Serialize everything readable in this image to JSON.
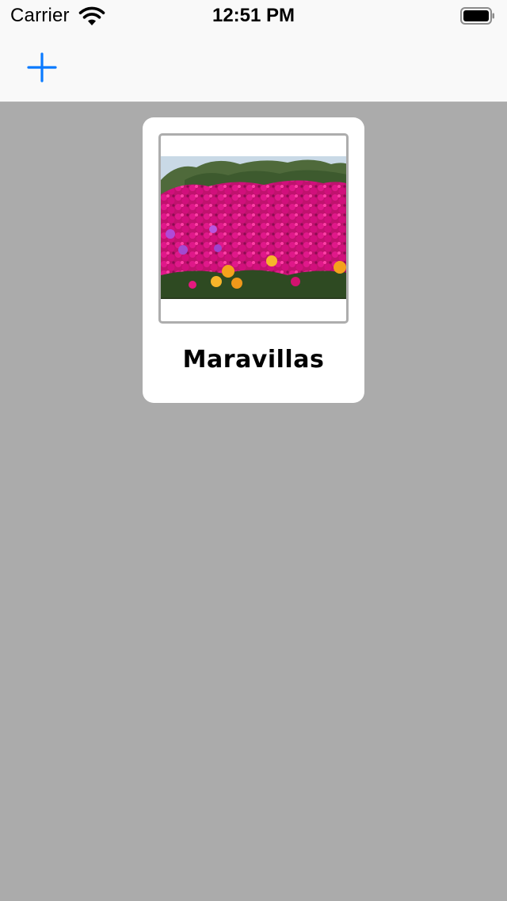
{
  "status_bar": {
    "carrier": "Carrier",
    "time": "12:51 PM",
    "wifi_icon": "wifi-icon",
    "battery_icon": "battery-full-icon"
  },
  "nav_bar": {
    "add_icon": "plus-icon",
    "accent_color": "#0a7aff"
  },
  "album": {
    "title": "Maravillas",
    "photo_subject": "field of magenta ice plant flowers"
  },
  "colors": {
    "background": "#ababab",
    "card": "#ffffff",
    "frame_border": "#adadad",
    "bar": "#f9f9f9"
  }
}
